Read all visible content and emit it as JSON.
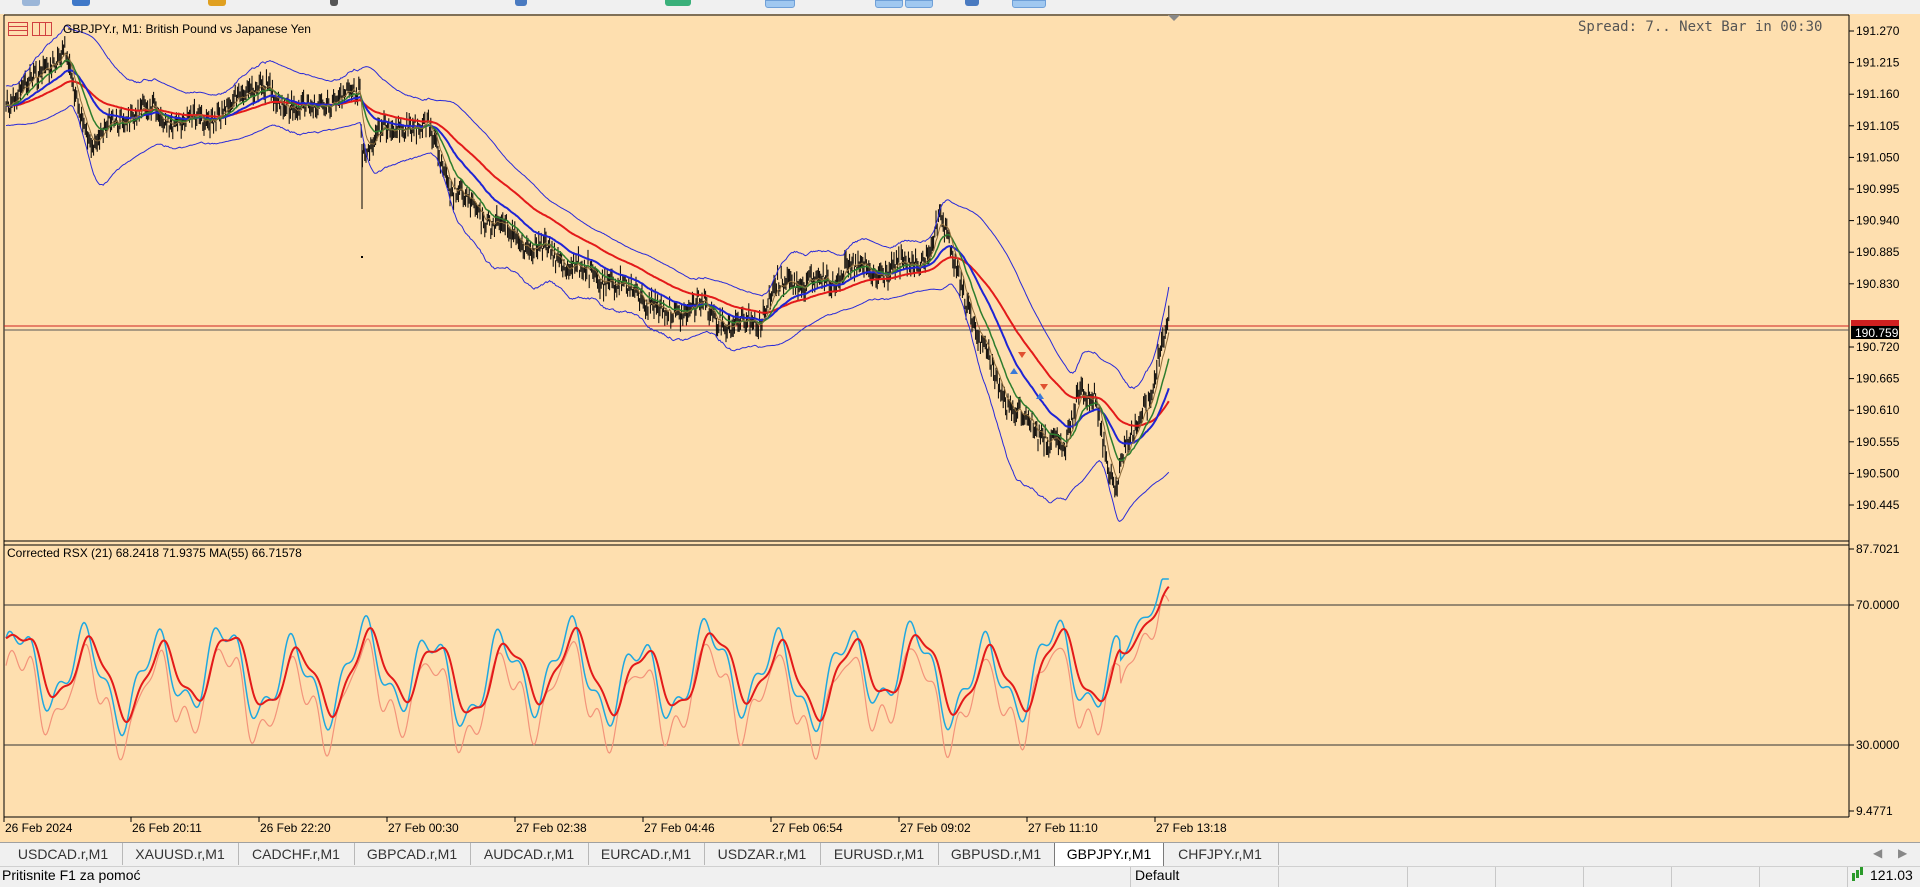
{
  "chart": {
    "header": "GBPJPY.r, M1:  British Pound vs Japanese Yen",
    "spread_info": "Spread: 7.. Next Bar in 00:30",
    "price_ticks": [
      "191.270",
      "191.215",
      "191.160",
      "191.105",
      "191.050",
      "190.995",
      "190.940",
      "190.885",
      "190.830",
      "190.720",
      "190.665",
      "190.610",
      "190.555",
      "190.500",
      "190.445"
    ],
    "current_price": "190.759",
    "indicator_label": "Corrected RSX (21) 68.2418 71.9375 MA(55) 66.71578",
    "indicator_ticks": [
      "87.7021",
      "70.0000",
      "30.0000",
      "9.4771"
    ],
    "time_labels": [
      "26 Feb 2024",
      "26 Feb 20:11",
      "26 Feb 22:20",
      "27 Feb 00:30",
      "27 Feb 02:38",
      "27 Feb 04:46",
      "27 Feb 06:54",
      "27 Feb 09:02",
      "27 Feb 11:10",
      "27 Feb 13:18"
    ],
    "colors": {
      "background": "#fedfaf",
      "price": "#000000",
      "ma_fast": "#8b6a3a",
      "ma_green": "#2e7d2e",
      "ma_blue": "#1f24d4",
      "ma_red": "#e31a1a",
      "bands": "#2a2ad8",
      "rsx": "#1fa8e0",
      "rsx_low": "#f3937a",
      "rsx_ma": "#e31a1a"
    }
  },
  "tabs": [
    {
      "label": "USDCAD.r,M1"
    },
    {
      "label": "XAUUSD.r,M1"
    },
    {
      "label": "CADCHF.r,M1"
    },
    {
      "label": "GBPCAD.r,M1"
    },
    {
      "label": "AUDCAD.r,M1"
    },
    {
      "label": "EURCAD.r,M1"
    },
    {
      "label": "USDZAR.r,M1"
    },
    {
      "label": "EURUSD.r,M1"
    },
    {
      "label": "GBPUSD.r,M1"
    },
    {
      "label": "GBPJPY.r,M1",
      "active": true
    },
    {
      "label": "CHFJPY.r,M1"
    }
  ],
  "status": {
    "help": "Pritisnite F1 za pomoć",
    "profile": "Default",
    "traffic": "121.03"
  }
}
